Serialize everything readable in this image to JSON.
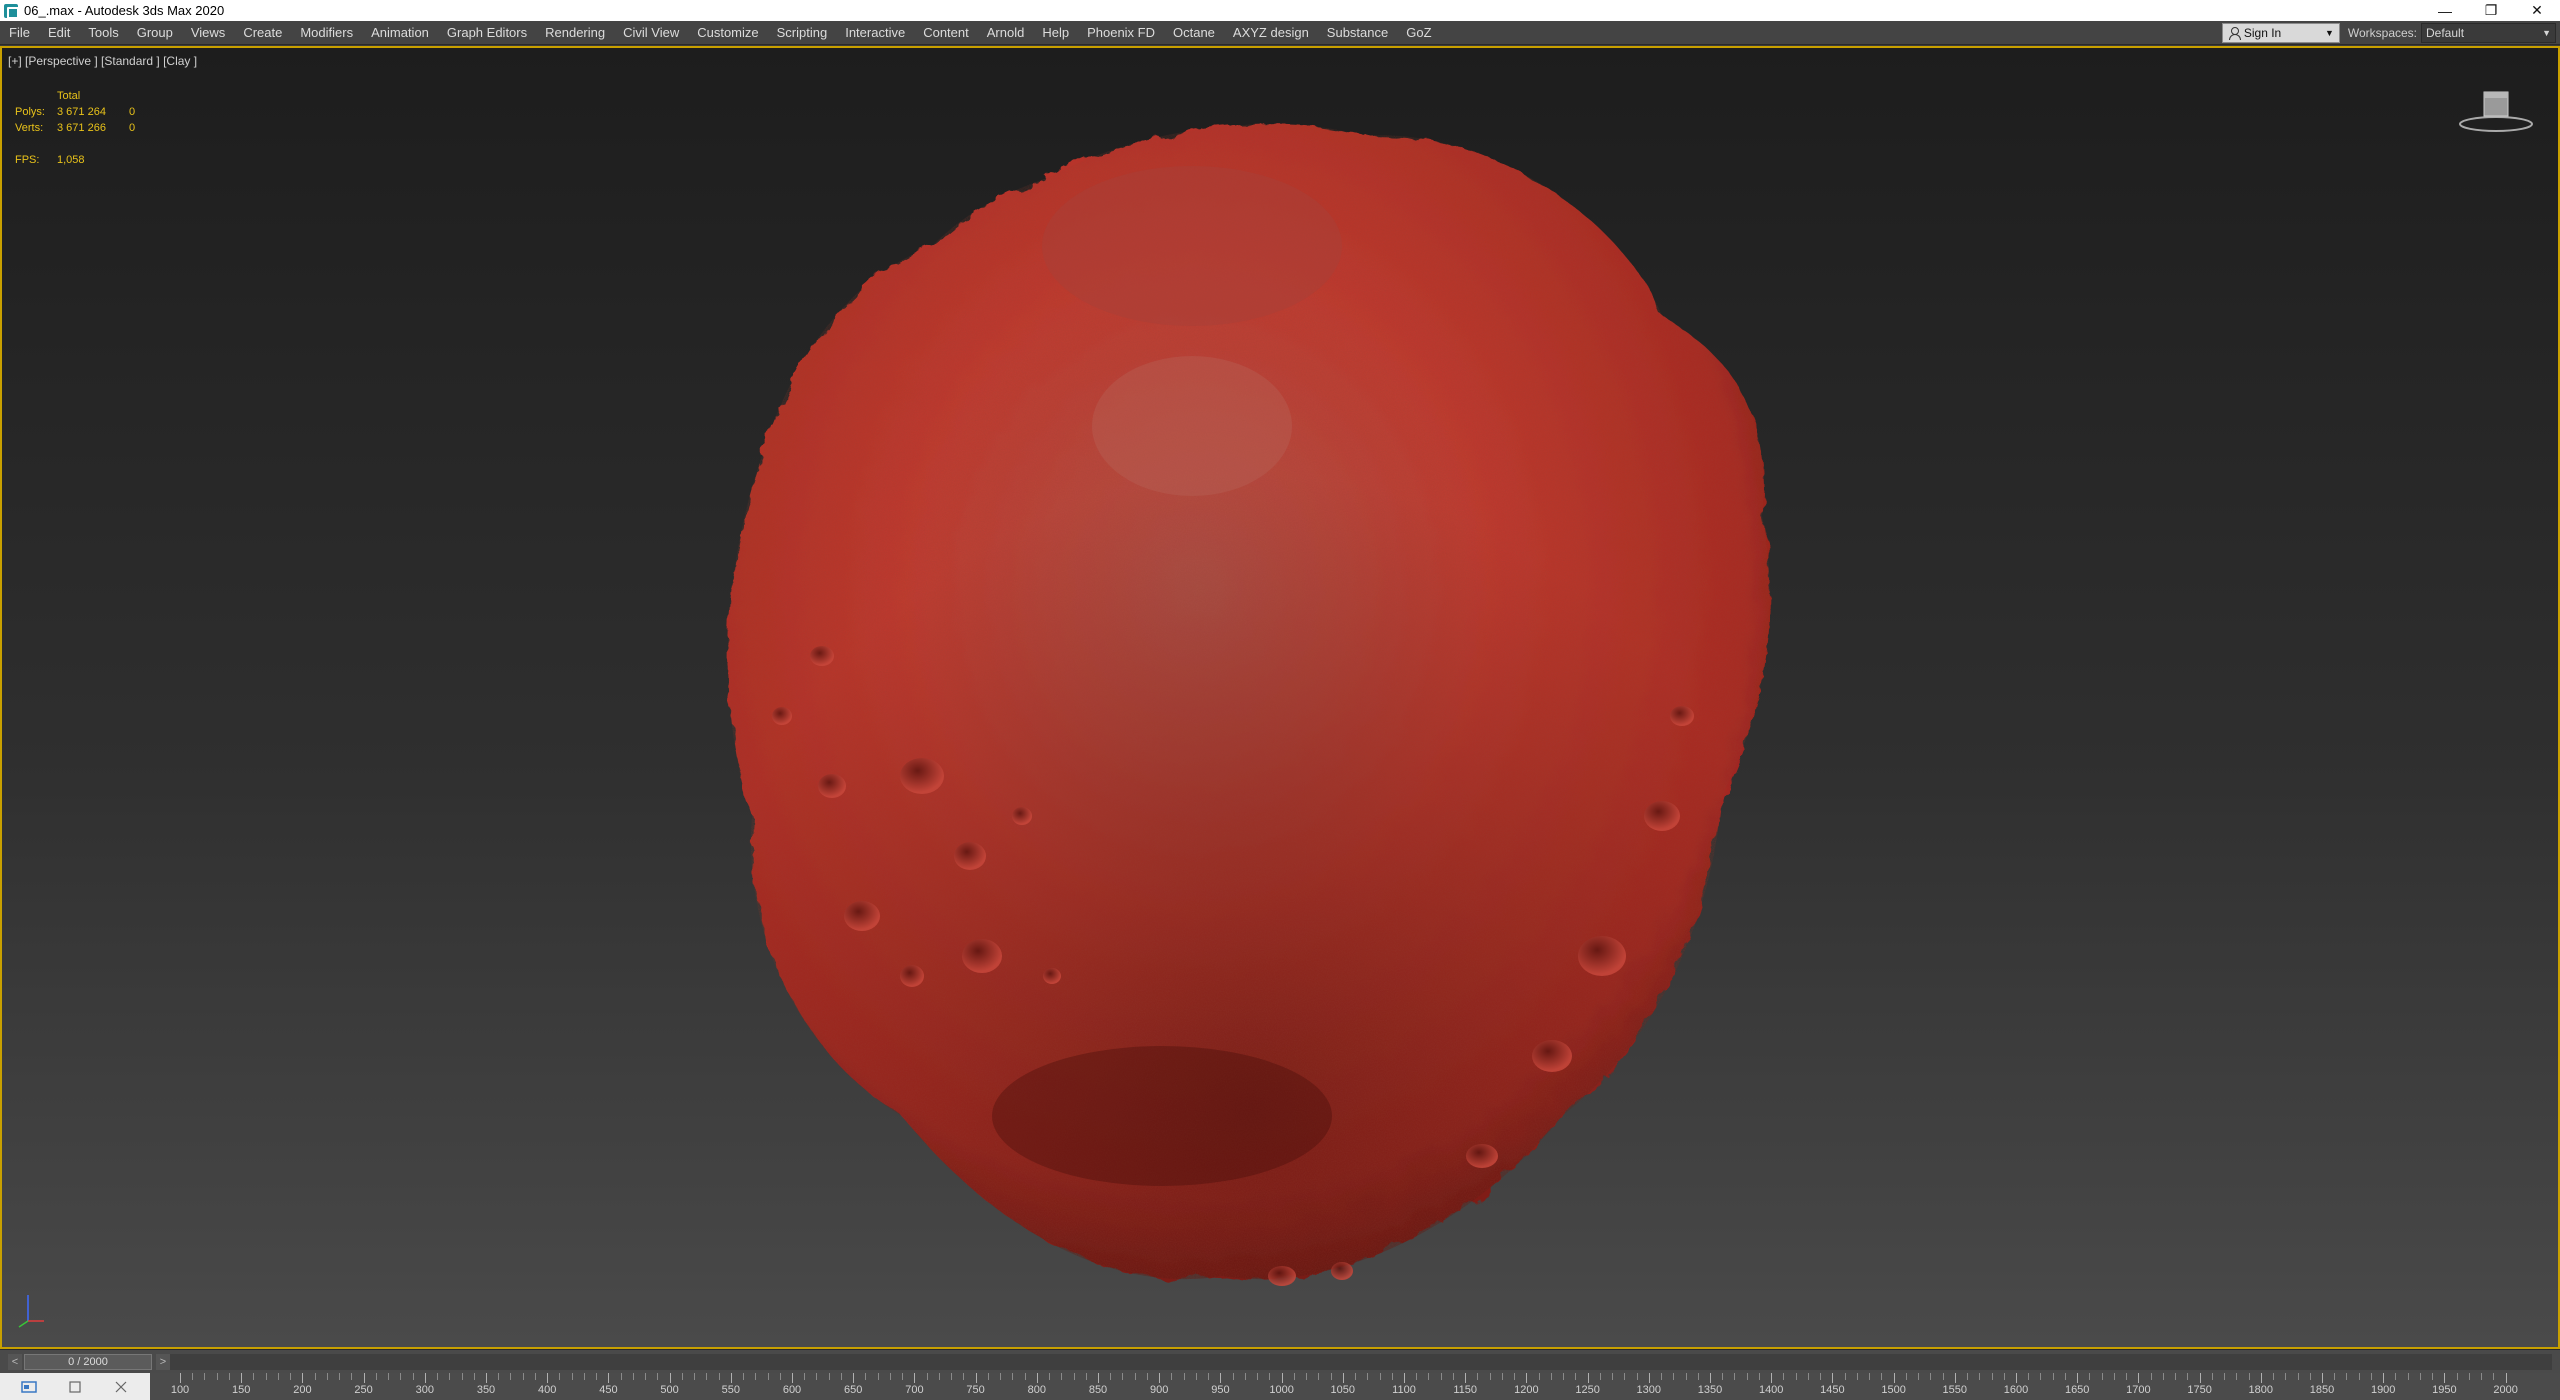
{
  "titlebar": {
    "title": "06_.max - Autodesk 3ds Max 2020",
    "app_icon": "3dsmax-icon",
    "buttons": [
      "minimize-icon",
      "restore-icon",
      "close-icon"
    ]
  },
  "menubar": {
    "items": [
      "File",
      "Edit",
      "Tools",
      "Group",
      "Views",
      "Create",
      "Modifiers",
      "Animation",
      "Graph Editors",
      "Rendering",
      "Civil View",
      "Customize",
      "Scripting",
      "Interactive",
      "Content",
      "Arnold",
      "Help",
      "Phoenix FD",
      "Octane",
      "AXYZ design",
      "Substance",
      "GoZ"
    ],
    "sign_in": "Sign In",
    "workspaces_label": "Workspaces:",
    "workspaces_value": "Default"
  },
  "viewport": {
    "label": "[+] [Perspective ] [Standard ] [Clay ]",
    "stats": {
      "header": "Total",
      "polys_label": "Polys:",
      "polys_value": "3 671 264",
      "polys_sel": "0",
      "verts_label": "Verts:",
      "verts_value": "3 671 266",
      "verts_sel": "0",
      "fps_label": "FPS:",
      "fps_value": "1,058"
    },
    "object": "asteroid-mesh",
    "colors": {
      "object": "#c8382e",
      "stats_text": "#e8c21a",
      "active_border": "#c8a000"
    }
  },
  "timeline": {
    "slider_text": "0 / 2000",
    "prev_label": "<",
    "next_label": ">"
  },
  "ruler": {
    "labels": [
      "100",
      "150",
      "200",
      "250",
      "300",
      "350",
      "400",
      "450",
      "500",
      "550",
      "600",
      "650",
      "700",
      "750",
      "800",
      "850",
      "900",
      "950",
      "1000",
      "1050",
      "1100",
      "1150",
      "1200",
      "1250",
      "1300",
      "1350",
      "1400",
      "1450",
      "1500",
      "1550",
      "1600",
      "1650",
      "1700",
      "1750",
      "1800",
      "1850",
      "1900",
      "1950",
      "2000"
    ]
  }
}
